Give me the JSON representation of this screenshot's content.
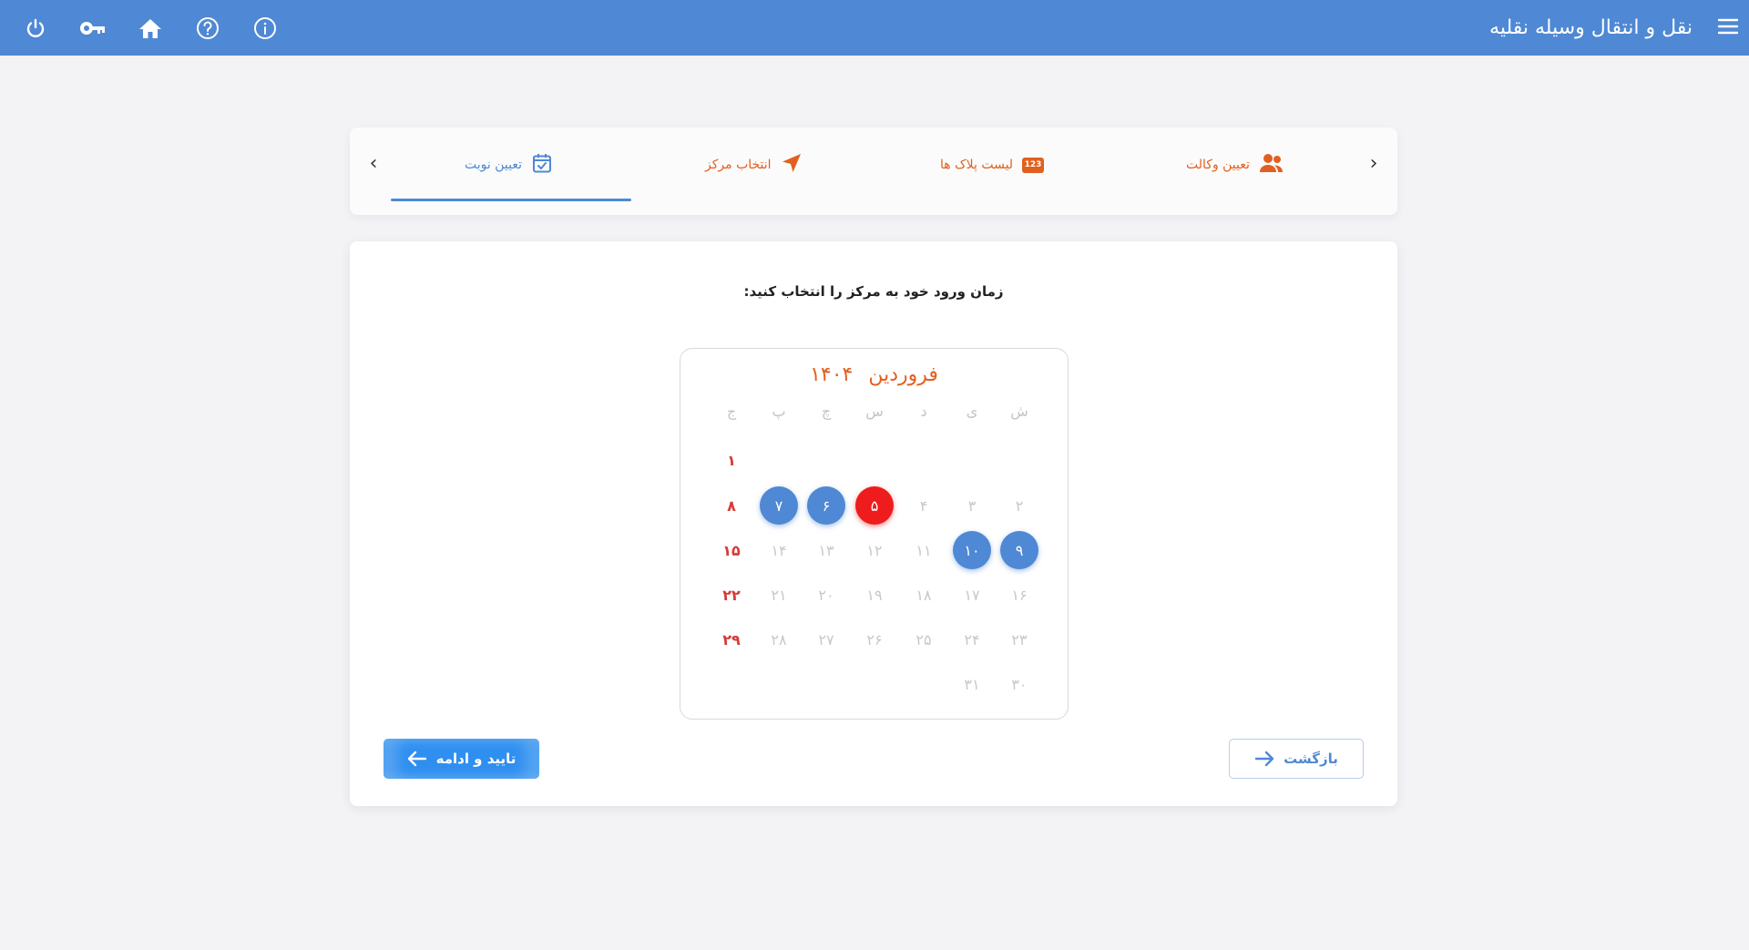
{
  "header": {
    "title": "نقل و انتقال وسیله نقلیه",
    "accent_color": "#4f88d4",
    "icons": [
      "power-icon",
      "key-icon",
      "home-icon",
      "help-icon",
      "info-icon",
      "menu-icon"
    ]
  },
  "stepper": {
    "tabs": [
      {
        "label": "تعیین وکالت",
        "icon": "users-icon",
        "active": false
      },
      {
        "label": "لیست پلاک ها",
        "icon": "plate-icon",
        "icon_text": "123",
        "active": false
      },
      {
        "label": "انتخاب مرکز",
        "icon": "location-arrow-icon",
        "active": false
      },
      {
        "label": "تعیین نوبت",
        "icon": "calendar-check-icon",
        "active": true
      }
    ]
  },
  "main": {
    "prompt": "زمان ورود خود به مرکز را انتخاب کنید:",
    "calendar": {
      "month": "فروردین",
      "year": "۱۴۰۴",
      "weekdays": [
        "ش",
        "ی",
        "د",
        "س",
        "چ",
        "پ",
        "ج"
      ],
      "weeks": [
        [
          "",
          "",
          "",
          "",
          "",
          "",
          "۱"
        ],
        [
          "۲",
          "۳",
          "۴",
          "۵",
          "۶",
          "۷",
          "۸"
        ],
        [
          "۹",
          "۱۰",
          "۱۱",
          "۱۲",
          "۱۳",
          "۱۴",
          "۱۵"
        ],
        [
          "۱۶",
          "۱۷",
          "۱۸",
          "۱۹",
          "۲۰",
          "۲۱",
          "۲۲"
        ],
        [
          "۲۳",
          "۲۴",
          "۲۵",
          "۲۶",
          "۲۷",
          "۲۸",
          "۲۹"
        ],
        [
          "۳۰",
          "۳۱",
          "",
          "",
          "",
          "",
          ""
        ]
      ],
      "available_days": [
        "۶",
        "۷",
        "۹",
        "۱۰"
      ],
      "selected_day": "۵",
      "colors": {
        "available": "#4f88d4",
        "selected": "#ee1c1c",
        "holiday": "#d63a3a",
        "month_title": "#e2601f"
      }
    },
    "buttons": {
      "confirm_label": "تایید و ادامه",
      "back_label": "بازگشت"
    }
  }
}
